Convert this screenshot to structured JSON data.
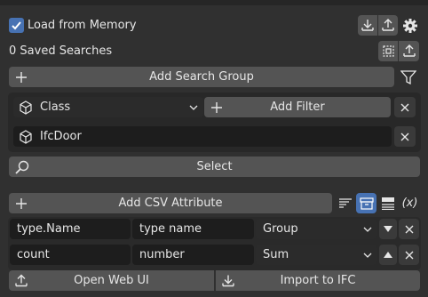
{
  "header": {
    "load_from_memory_label": "Load from Memory",
    "load_from_memory_checked": true,
    "saved_searches_label": "0 Saved Searches"
  },
  "search": {
    "add_group_label": "Add Search Group",
    "filter_type_value": "Class",
    "add_filter_label": "Add Filter",
    "class_value": "IfcDoor",
    "select_label": "Select"
  },
  "csv": {
    "add_attribute_label": "Add CSV Attribute",
    "rows": [
      {
        "attribute": "type.Name",
        "name": "type name",
        "mode": "Group"
      },
      {
        "attribute": "count",
        "name": "number",
        "mode": "Sum"
      }
    ],
    "open_web_ui_label": "Open Web UI",
    "import_to_ifc_label": "Import to IFC",
    "formula_label": "(x)"
  },
  "colors": {
    "accent": "#4772b3",
    "button": "#545454",
    "field": "#1d1d1d",
    "panel": "#282828",
    "background": "#303030"
  }
}
